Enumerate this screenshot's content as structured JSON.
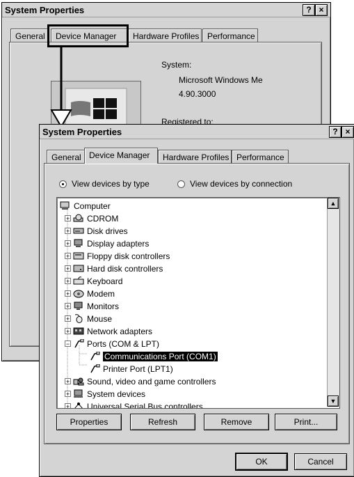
{
  "back_window": {
    "title": "System Properties",
    "tabs": [
      "General",
      "Device Manager",
      "Hardware Profiles",
      "Performance"
    ],
    "system_label": "System:",
    "os_name": "Microsoft Windows Me",
    "os_version": "4.90.3000",
    "registered_label": "Registered to:"
  },
  "front_window": {
    "title": "System Properties",
    "help_btn": "?",
    "close_btn": "×",
    "tabs": [
      "General",
      "Device Manager",
      "Hardware Profiles",
      "Performance"
    ],
    "view_by_type": "View devices by type",
    "view_by_connection": "View devices by connection",
    "tree": [
      {
        "label": "Computer",
        "level": 0,
        "expander": "",
        "icon": "computer-icon"
      },
      {
        "label": "CDROM",
        "level": 1,
        "expander": "+",
        "icon": "cdrom-icon"
      },
      {
        "label": "Disk drives",
        "level": 1,
        "expander": "+",
        "icon": "disk-drive-icon"
      },
      {
        "label": "Display adapters",
        "level": 1,
        "expander": "+",
        "icon": "display-adapter-icon"
      },
      {
        "label": "Floppy disk controllers",
        "level": 1,
        "expander": "+",
        "icon": "floppy-controller-icon"
      },
      {
        "label": "Hard disk controllers",
        "level": 1,
        "expander": "+",
        "icon": "hard-disk-controller-icon"
      },
      {
        "label": "Keyboard",
        "level": 1,
        "expander": "+",
        "icon": "keyboard-icon"
      },
      {
        "label": "Modem",
        "level": 1,
        "expander": "+",
        "icon": "modem-icon"
      },
      {
        "label": "Monitors",
        "level": 1,
        "expander": "+",
        "icon": "monitor-icon"
      },
      {
        "label": "Mouse",
        "level": 1,
        "expander": "+",
        "icon": "mouse-icon"
      },
      {
        "label": "Network adapters",
        "level": 1,
        "expander": "+",
        "icon": "network-adapter-icon"
      },
      {
        "label": "Ports (COM & LPT)",
        "level": 1,
        "expander": "−",
        "icon": "port-icon"
      },
      {
        "label": "Communications Port (COM1)",
        "level": 2,
        "expander": "",
        "icon": "port-icon",
        "selected": true
      },
      {
        "label": "Printer Port (LPT1)",
        "level": 2,
        "expander": "",
        "icon": "port-icon"
      },
      {
        "label": "Sound, video and game controllers",
        "level": 1,
        "expander": "+",
        "icon": "sound-icon"
      },
      {
        "label": "System devices",
        "level": 1,
        "expander": "+",
        "icon": "system-devices-icon"
      },
      {
        "label": "Universal Serial Bus controllers",
        "level": 1,
        "expander": "+",
        "icon": "usb-icon"
      }
    ],
    "buttons": {
      "properties": "Properties",
      "refresh": "Refresh",
      "remove": "Remove",
      "print": "Print..."
    },
    "ok": "OK",
    "cancel": "Cancel"
  },
  "colors": {
    "highlight": "#000000",
    "dialog": "#d4d4d4"
  }
}
